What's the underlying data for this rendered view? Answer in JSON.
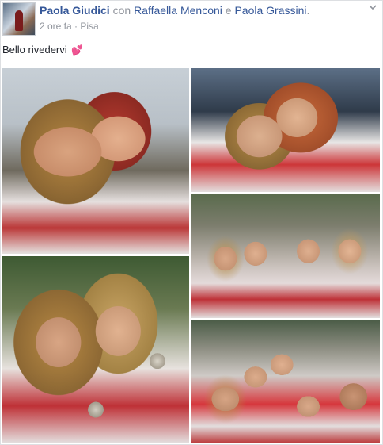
{
  "post": {
    "author": "Paola Giudici",
    "connector_with": "con",
    "tagged_1": "Raffaella Menconi",
    "connector_and": "e",
    "tagged_2": "Paola Grassini",
    "period": ".",
    "time": "2 ore fa",
    "separator": "·",
    "location": "Pisa",
    "text": "Bello rivedervi",
    "emoji": "💕"
  },
  "icons": {
    "avatar": "profile-avatar",
    "menu": "chevron-down-icon"
  },
  "photos": {
    "count": 5,
    "layout": "1 large left-top, 2 stacked right-top, 1 large left-bottom, 1 right-bottom"
  },
  "colors": {
    "link": "#365899",
    "meta": "#90949c",
    "text": "#1d2129",
    "border": "#dddfe2"
  }
}
